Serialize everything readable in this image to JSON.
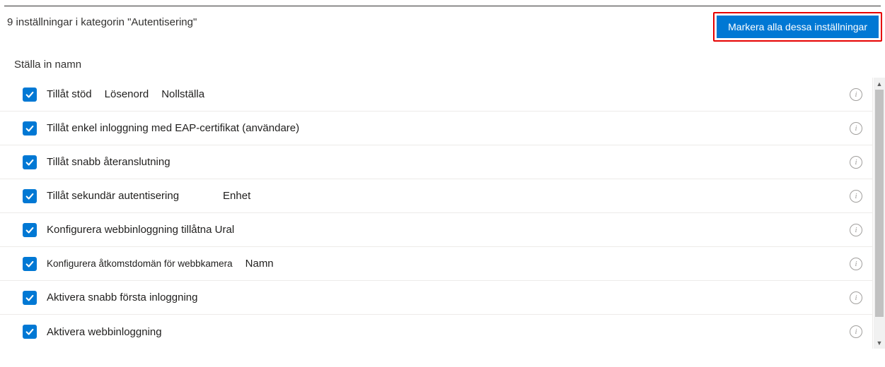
{
  "header": {
    "count_label": "9",
    "category_text": "inställningar i kategorin \"Autentisering\"",
    "select_all_label": "Markera alla dessa inställningar"
  },
  "column_header": "Ställa in namn",
  "rows": [
    {
      "label": "Tillåt stöd",
      "sub1": "Lösenord",
      "sub2": "Nollställa",
      "small": false,
      "gap": "normal"
    },
    {
      "label": "Tillåt enkel inloggning med EAP-certifikat (användare)",
      "sub1": "",
      "sub2": "",
      "small": false,
      "gap": "normal"
    },
    {
      "label": "Tillåt snabb återanslutning",
      "sub1": "",
      "sub2": "",
      "small": false,
      "gap": "normal"
    },
    {
      "label": "Tillåt sekundär autentisering",
      "sub1": "Enhet",
      "sub2": "",
      "small": false,
      "gap": "wide"
    },
    {
      "label": "Konfigurera webbinloggning tillåtna Ural",
      "sub1": "",
      "sub2": "",
      "small": false,
      "gap": "normal"
    },
    {
      "label": "Konfigurera åtkomstdomän för webbkamera",
      "sub1": "Namn",
      "sub2": "",
      "small": true,
      "gap": "normal"
    },
    {
      "label": "Aktivera snabb första inloggning",
      "sub1": "",
      "sub2": "",
      "small": false,
      "gap": "normal"
    },
    {
      "label": "Aktivera webbinloggning",
      "sub1": "",
      "sub2": "",
      "small": false,
      "gap": "normal"
    }
  ]
}
